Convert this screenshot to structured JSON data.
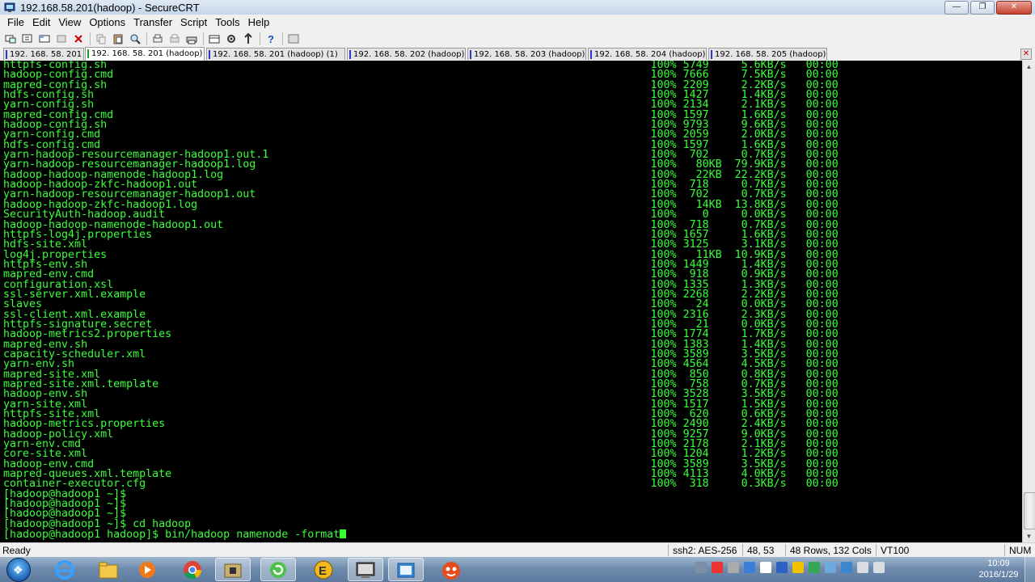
{
  "window": {
    "title": "192.168.58.201(hadoop) - SecureCRT"
  },
  "menu": [
    "File",
    "Edit",
    "View",
    "Options",
    "Transfer",
    "Script",
    "Tools",
    "Help"
  ],
  "toolbar_icons": [
    "connect-icon",
    "quick-connect-icon",
    "connect-tab-icon",
    "reconnect-icon",
    "disconnect-icon",
    "copy-icon",
    "paste-icon",
    "find-icon",
    "print-icon",
    "print-selection-icon",
    "printer-icon",
    "session-options-icon",
    "global-options-icon",
    "sftp-icon",
    "help-icon",
    "keymap-icon"
  ],
  "tabs": [
    {
      "label": "192. 168. 58. 201",
      "active": false
    },
    {
      "label": "192. 168. 58. 201 (hadoop)",
      "active": true
    },
    {
      "label": "192. 168. 58. 201 (hadoop)    (1)",
      "active": false
    },
    {
      "label": "192. 168. 58. 202 (hadoop)",
      "active": false
    },
    {
      "label": "192. 168. 58. 203 (hadoop)",
      "active": false
    },
    {
      "label": "192. 168. 58. 204 (hadoop)",
      "active": false
    },
    {
      "label": "192. 168. 58. 205 (hadoop)",
      "active": false
    }
  ],
  "terminal": {
    "lines": [
      "httpfs-config.sh                                                                                    100% 5749     5.6KB/s   00:00",
      "hadoop-config.cmd                                                                                   100% 7666     7.5KB/s   00:00",
      "mapred-config.sh                                                                                    100% 2209     2.2KB/s   00:00",
      "hdfs-config.sh                                                                                      100% 1427     1.4KB/s   00:00",
      "yarn-config.sh                                                                                      100% 2134     2.1KB/s   00:00",
      "mapred-config.cmd                                                                                   100% 1597     1.6KB/s   00:00",
      "hadoop-config.sh                                                                                    100% 9793     9.6KB/s   00:00",
      "yarn-config.cmd                                                                                     100% 2059     2.0KB/s   00:00",
      "hdfs-config.cmd                                                                                     100% 1597     1.6KB/s   00:00",
      "yarn-hadoop-resourcemanager-hadoop1.out.1                                                           100%  702     0.7KB/s   00:00",
      "yarn-hadoop-resourcemanager-hadoop1.log                                                             100%   80KB  79.9KB/s   00:00",
      "hadoop-hadoop-namenode-hadoop1.log                                                                  100%   22KB  22.2KB/s   00:00",
      "hadoop-hadoop-zkfc-hadoop1.out                                                                      100%  718     0.7KB/s   00:00",
      "yarn-hadoop-resourcemanager-hadoop1.out                                                             100%  702     0.7KB/s   00:00",
      "hadoop-hadoop-zkfc-hadoop1.log                                                                      100%   14KB  13.8KB/s   00:00",
      "SecurityAuth-hadoop.audit                                                                           100%    0     0.0KB/s   00:00",
      "hadoop-hadoop-namenode-hadoop1.out                                                                  100%  718     0.7KB/s   00:00",
      "httpfs-log4j.properties                                                                             100% 1657     1.6KB/s   00:00",
      "hdfs-site.xml                                                                                       100% 3125     3.1KB/s   00:00",
      "log4j.properties                                                                                    100%   11KB  10.9KB/s   00:00",
      "httpfs-env.sh                                                                                       100% 1449     1.4KB/s   00:00",
      "mapred-env.cmd                                                                                      100%  918     0.9KB/s   00:00",
      "configuration.xsl                                                                                   100% 1335     1.3KB/s   00:00",
      "ssl-server.xml.example                                                                              100% 2268     2.2KB/s   00:00",
      "slaves                                                                                              100%   24     0.0KB/s   00:00",
      "ssl-client.xml.example                                                                              100% 2316     2.3KB/s   00:00",
      "httpfs-signature.secret                                                                             100%   21     0.0KB/s   00:00",
      "hadoop-metrics2.properties                                                                          100% 1774     1.7KB/s   00:00",
      "mapred-env.sh                                                                                       100% 1383     1.4KB/s   00:00",
      "capacity-scheduler.xml                                                                              100% 3589     3.5KB/s   00:00",
      "yarn-env.sh                                                                                         100% 4564     4.5KB/s   00:00",
      "mapred-site.xml                                                                                     100%  850     0.8KB/s   00:00",
      "mapred-site.xml.template                                                                            100%  758     0.7KB/s   00:00",
      "hadoop-env.sh                                                                                       100% 3528     3.5KB/s   00:00",
      "yarn-site.xml                                                                                       100% 1517     1.5KB/s   00:00",
      "httpfs-site.xml                                                                                     100%  620     0.6KB/s   00:00",
      "hadoop-metrics.properties                                                                           100% 2490     2.4KB/s   00:00",
      "hadoop-policy.xml                                                                                   100% 9257     9.0KB/s   00:00",
      "yarn-env.cmd                                                                                        100% 2178     2.1KB/s   00:00",
      "core-site.xml                                                                                       100% 1204     1.2KB/s   00:00",
      "hadoop-env.cmd                                                                                      100% 3589     3.5KB/s   00:00",
      "mapred-queues.xml.template                                                                          100% 4113     4.0KB/s   00:00",
      "container-executor.cfg                                                                              100%  318     0.3KB/s   00:00",
      "[hadoop@hadoop1 ~]$",
      "[hadoop@hadoop1 ~]$",
      "[hadoop@hadoop1 ~]$",
      "[hadoop@hadoop1 ~]$ cd hadoop"
    ],
    "current_line": "[hadoop@hadoop1 hadoop]$ bin/hadoop namenode -format"
  },
  "status": {
    "state": "Ready",
    "cipher": "ssh2: AES-256",
    "cursor_pos": "48, 53",
    "size": "48 Rows, 132 Cols",
    "emulation": "VT100",
    "num": "NUM"
  },
  "taskbar": {
    "apps": [
      "internet-explorer-icon",
      "file-explorer-icon",
      "media-player-icon",
      "chrome-icon",
      "app-folder-icon",
      "green-refresh-icon",
      "e-app-icon",
      "securecrt-icon",
      "outlook-app-icon",
      "game-app-icon"
    ],
    "clock": {
      "time": "10:09",
      "date": "2016/1/29"
    }
  }
}
